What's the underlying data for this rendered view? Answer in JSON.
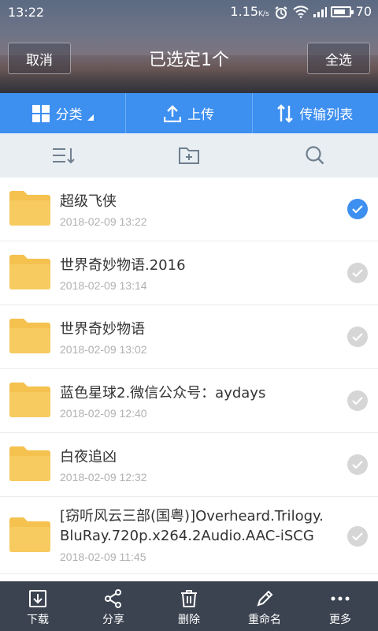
{
  "status": {
    "time": "13:22",
    "speed": "1.15",
    "speed_unit": "K/s",
    "battery": "70"
  },
  "header": {
    "cancel": "取消",
    "title": "已选定1个",
    "select_all": "全选"
  },
  "tabs": {
    "category": "分类",
    "upload": "上传",
    "transfer": "传输列表"
  },
  "files": [
    {
      "name": "超级飞侠",
      "date": "2018-02-09  13:22",
      "checked": true
    },
    {
      "name": "世界奇妙物语.2016",
      "date": "2018-02-09  13:14",
      "checked": false
    },
    {
      "name": "世界奇妙物语",
      "date": "2018-02-09  13:02",
      "checked": false
    },
    {
      "name": "蓝色星球2.微信公众号：aydays",
      "date": "2018-02-09  12:40",
      "checked": false
    },
    {
      "name": "白夜追凶",
      "date": "2018-02-09  12:32",
      "checked": false
    },
    {
      "name_line1": "[窃听风云三部(国粤)]Overheard.Trilogy.",
      "name_line2": "BluRay.720p.x264.2Audio.AAC-iSCG",
      "date": "2018-02-09  11:45",
      "checked": false
    }
  ],
  "bottom": {
    "download": "下载",
    "share": "分享",
    "delete": "删除",
    "rename": "重命名",
    "more": "更多"
  },
  "colors": {
    "accent": "#3d8ff0",
    "folder": "#f5c14f",
    "bottom_bar": "#3b4350"
  }
}
